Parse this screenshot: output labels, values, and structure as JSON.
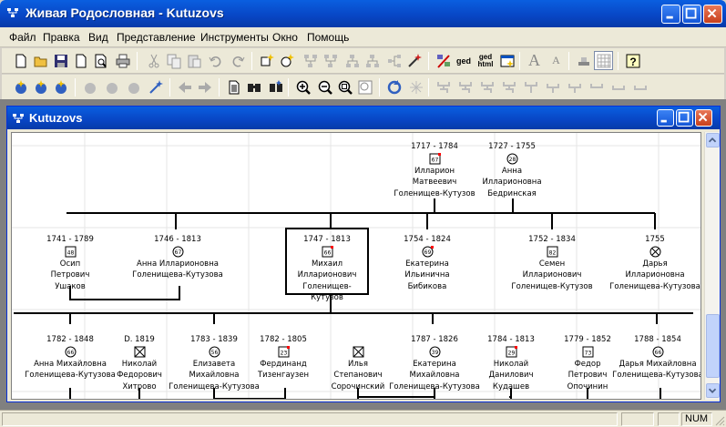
{
  "app": {
    "title": "Живая Родословная - Kutuzovs"
  },
  "menu": [
    "Файл",
    "Правка",
    "Вид",
    "Представление",
    "Инструменты",
    "Окно",
    "Помощь"
  ],
  "toolbar1": [
    "new-icon",
    "open-icon",
    "save-icon",
    "page-icon",
    "print-preview-icon",
    "print-icon",
    "cut-icon",
    "copy-icon",
    "paste-icon",
    "undo-icon",
    "redo-icon",
    "new-person-icon",
    "new-male-icon",
    "tree-icon-1",
    "tree-icon-2",
    "tree-icon-3",
    "tree-icon-4",
    "wand-icon",
    "ged-icon",
    "ged-html-icon",
    "web-icon",
    "font-large-icon",
    "font-small-icon",
    "stamp-icon",
    "grid-icon",
    "help-icon"
  ],
  "toolbar1_text": {
    "ged": "ged",
    "gedhtml_1": "ged",
    "gedhtml_2": "html"
  },
  "toolbar2": [
    "gen1-icon",
    "gen2-icon",
    "gen3-icon",
    "person-add-icon",
    "person-add2-icon",
    "person-add3-icon",
    "person-flag-icon",
    "back-icon",
    "forward-icon",
    "document-icon",
    "find-icon",
    "find2-icon",
    "zoom-in-icon",
    "zoom-out-icon",
    "zoom-fit-icon",
    "zoom-page-icon",
    "refresh-icon",
    "layout-icon",
    "layout-a-icon",
    "layout-b-icon",
    "layout-c-icon",
    "layout-d-icon",
    "layout-e-icon",
    "layout-f-icon",
    "layout-g-icon",
    "layout-h-icon",
    "layout-i-icon",
    "layout-j-icon",
    "layout-k-icon"
  ],
  "child": {
    "title": "Kutuzovs"
  },
  "people": {
    "p1": {
      "years": "1717 - 1784",
      "age": "67",
      "icon": "male",
      "line1": "Илларион",
      "line2": "Матвеевич",
      "line3": "Голенищев-Кутузов"
    },
    "p2": {
      "years": "1727 - 1755",
      "age": "28",
      "icon": "female",
      "line1": "Анна",
      "line2": "Илларионовна",
      "line3": "Бедринская"
    },
    "p3": {
      "years": "1741 - 1789",
      "age": "48",
      "icon": "male",
      "line1": "Осип",
      "line2": "Петрович",
      "line3": "Ушаков"
    },
    "p4": {
      "years": "1746 - 1813",
      "age": "67",
      "icon": "female",
      "line1": "Анна Илларионовна",
      "line2": "Голенищева-Кутузова",
      "line3": ""
    },
    "p5": {
      "years": "1747 - 1813",
      "age": "66",
      "icon": "male",
      "line1": "Михаил",
      "line2": "Илларионович",
      "line3": "Голенищев-Кутузов"
    },
    "p6": {
      "years": "1754 - 1824",
      "age": "69",
      "icon": "female",
      "line1": "Екатерина",
      "line2": "Ильинична",
      "line3": "Бибикова"
    },
    "p7": {
      "years": "1752 - 1834",
      "age": "82",
      "icon": "male",
      "line1": "Семен",
      "line2": "Илларионович",
      "line3": "Голенищев-Кутузов"
    },
    "p8": {
      "years": "1755",
      "age": "",
      "icon": "female-x",
      "line1": "Дарья",
      "line2": "Илларионовна",
      "line3": "Голенищева-Кутузова"
    },
    "p9": {
      "years": "1782 - 1848",
      "age": "66",
      "icon": "female",
      "line1": "Анна Михайловна",
      "line2": "Голенищева-Кутузова",
      "line3": ""
    },
    "p10": {
      "years": "D. 1819",
      "age": "",
      "icon": "male-x",
      "line1": "Николай",
      "line2": "Федорович",
      "line3": "Хитрово"
    },
    "p11": {
      "years": "1783 - 1839",
      "age": "56",
      "icon": "female",
      "line1": "Елизавета",
      "line2": "Михайловна",
      "line3": "Голенищева-Кутузова"
    },
    "p12": {
      "years": "1782 - 1805",
      "age": "23",
      "icon": "male",
      "line1": "Фердинанд",
      "line2": "Тизенгаузен",
      "line3": ""
    },
    "p13": {
      "years": "",
      "age": "",
      "icon": "male-x",
      "line1": "Илья",
      "line2": "Степанович",
      "line3": "Сорочинский"
    },
    "p14": {
      "years": "1787 - 1826",
      "age": "39",
      "icon": "female",
      "line1": "Екатерина",
      "line2": "Михайловна",
      "line3": "Голенищева-Кутузова"
    },
    "p15": {
      "years": "1784 - 1813",
      "age": "29",
      "icon": "male",
      "line1": "Николай",
      "line2": "Данилович",
      "line3": "Кудашев"
    },
    "p16": {
      "years": "1779 - 1852",
      "age": "73",
      "icon": "male",
      "line1": "Федор",
      "line2": "Петрович",
      "line3": "Опочинин"
    },
    "p17": {
      "years": "1788 - 1854",
      "age": "66",
      "icon": "female",
      "line1": "Дарья Михайловна",
      "line2": "Голенищева-Кутузова",
      "line3": ""
    }
  },
  "status": {
    "num": "NUM"
  },
  "colors": {
    "titlebar": "#0845c4",
    "marker": "#ff0000",
    "line": "#000000"
  }
}
